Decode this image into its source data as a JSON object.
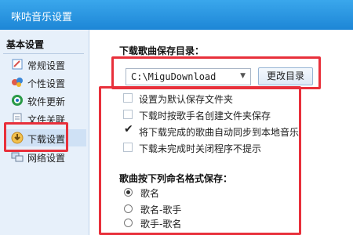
{
  "window": {
    "title": "咪咕音乐设置"
  },
  "sidebar": {
    "group_title": "基本设置",
    "items": [
      {
        "label": "常规设置",
        "icon": "general-settings-icon",
        "color": "#5f8fc9"
      },
      {
        "label": "个性设置",
        "icon": "personalize-icon",
        "color": "#e05a4b"
      },
      {
        "label": "软件更新",
        "icon": "update-icon",
        "color": "#2a9a47"
      },
      {
        "label": "文件关联",
        "icon": "file-association-icon",
        "color": "#7a8ea8"
      },
      {
        "label": "下载设置",
        "icon": "download-icon",
        "color": "#c48a1f",
        "active": true
      },
      {
        "label": "网络设置",
        "icon": "network-icon",
        "color": "#6b7f99"
      }
    ]
  },
  "download": {
    "save_dir_heading": "下载歌曲保存目录：",
    "save_dir_value": "C:\\MiguDownload",
    "change_dir_button": "更改目录",
    "options": [
      {
        "label": "设置为默认保存文件夹",
        "checked": false
      },
      {
        "label": "下载时按歌手名创建文件夹保存",
        "checked": false
      },
      {
        "label": "将下载完成的歌曲自动同步到本地音乐",
        "checked": true
      },
      {
        "label": "下载未完成时关闭程序不提示",
        "checked": false
      }
    ],
    "naming_heading": "歌曲按下列命名格式保存：",
    "naming_options": [
      {
        "label": "歌名",
        "selected": true
      },
      {
        "label": "歌名-歌手",
        "selected": false
      },
      {
        "label": "歌手-歌名",
        "selected": false
      }
    ]
  },
  "colors": {
    "titlebar": "#2796e2",
    "highlight": "#e8303b",
    "sidebar_bg": "#e7f0fa"
  }
}
